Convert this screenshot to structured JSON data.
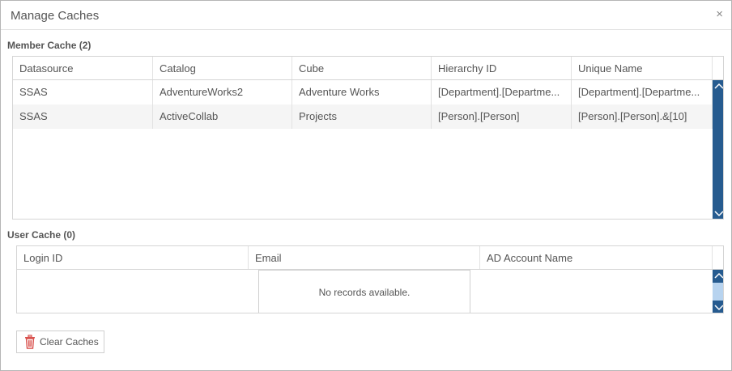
{
  "dialog": {
    "title": "Manage Caches",
    "close_glyph": "×"
  },
  "member_cache": {
    "label": "Member Cache (2)",
    "columns": [
      "Datasource",
      "Catalog",
      "Cube",
      "Hierarchy ID",
      "Unique Name"
    ],
    "rows": [
      [
        "SSAS",
        "AdventureWorks2",
        "Adventure Works",
        "[Department].[Departme...",
        "[Department].[Departme..."
      ],
      [
        "SSAS",
        "ActiveCollab",
        "Projects",
        "[Person].[Person]",
        "[Person].[Person].&[10]"
      ]
    ]
  },
  "user_cache": {
    "label": "User Cache (0)",
    "columns": [
      "Login ID",
      "Email",
      "AD Account Name"
    ],
    "empty_message": "No records available."
  },
  "footer": {
    "clear_button_label": "Clear Caches"
  },
  "colors": {
    "scrollbar": "#265b8f",
    "scrollbar_light": "#b7d3ef",
    "trash_icon": "#d9534f"
  },
  "icons": {
    "close": "close-icon",
    "clear": "trash-icon",
    "scroll_up": "chevron-up-icon",
    "scroll_down": "chevron-down-icon"
  }
}
